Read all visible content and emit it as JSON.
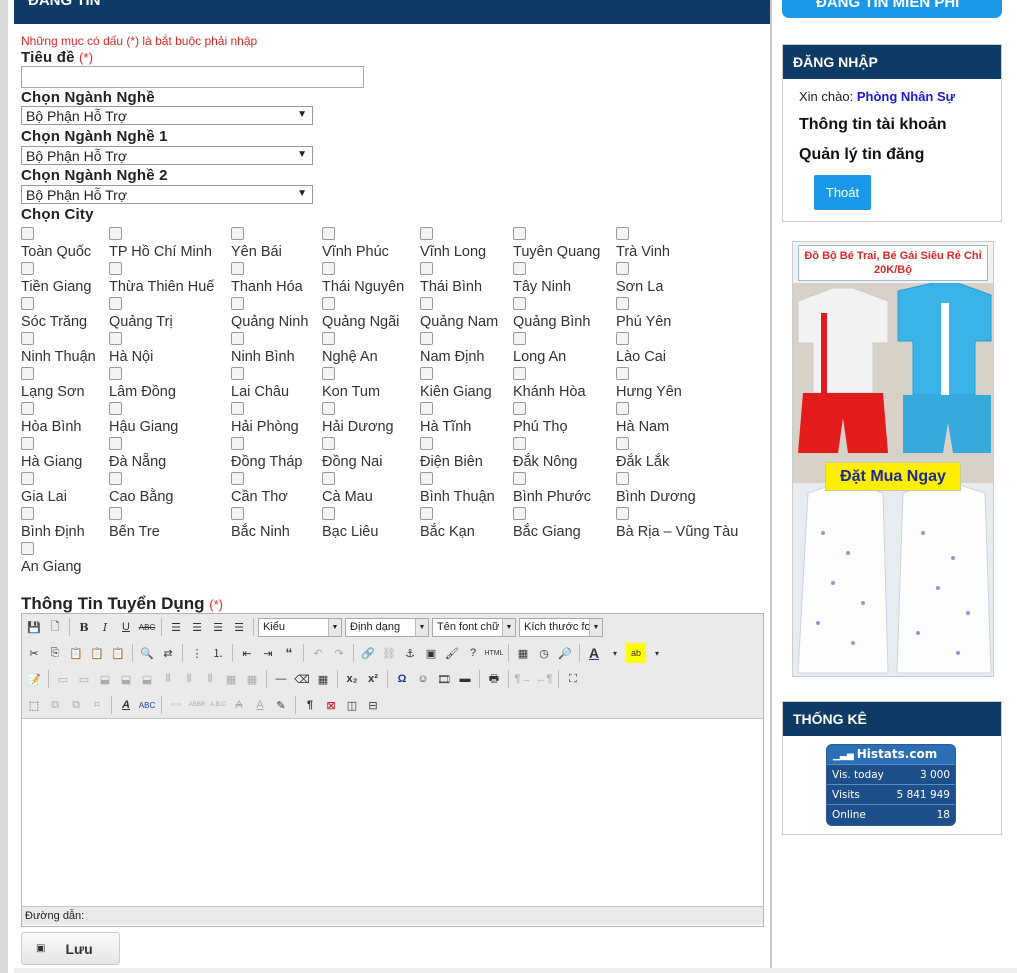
{
  "main": {
    "header_title": "ĐĂNG TIN",
    "required_note": "Những mục có dấu (*) là bắt buộc phải nhập",
    "title_label": "Tiêu đề",
    "required_mark": "(*)",
    "industry_label": "Chọn Ngành Nghề",
    "industry_value": "Bộ Phận Hỗ Trợ",
    "industry1_label": "Chọn Ngành Nghề 1",
    "industry1_value": "Bộ Phận Hỗ Trợ",
    "industry2_label": "Chọn Ngành Nghề 2",
    "industry2_value": "Bộ Phận Hỗ Trợ",
    "city_label": "Chọn City",
    "recruitment_label": "Thông Tin Tuyển Dụng",
    "save_label": "Lưu"
  },
  "cities": [
    [
      "Toàn Quốc",
      "TP Hồ Chí Minh",
      "Yên Bái",
      "Vĩnh Phúc",
      "Vĩnh Long",
      "Tuyên Quang",
      "Trà Vinh"
    ],
    [
      "Tiền Giang",
      "Thừa Thiên Huế",
      "Thanh Hóa",
      "Thái Nguyên",
      "Thái Bình",
      "Tây Ninh",
      "Sơn La"
    ],
    [
      "Sóc Trăng",
      "Quảng Trị",
      "Quảng Ninh",
      "Quảng Ngãi",
      "Quảng Nam",
      "Quảng Bình",
      "Phú Yên"
    ],
    [
      "Ninh Thuận",
      "Hà Nội",
      "Ninh Bình",
      "Nghệ An",
      "Nam Định",
      "Long An",
      "Lào Cai"
    ],
    [
      "Lạng Sơn",
      "Lâm Đồng",
      "Lai Châu",
      "Kon Tum",
      "Kiên Giang",
      "Khánh Hòa",
      "Hưng Yên"
    ],
    [
      "Hòa Bình",
      "Hậu Giang",
      "Hải Phòng",
      "Hải Dương",
      "Hà Tĩnh",
      "Phú Thọ",
      "Hà Nam"
    ],
    [
      "Hà Giang",
      "Đà Nẵng",
      "Đồng Tháp",
      "Đồng Nai",
      "Điện Biên",
      "Đắk Nông",
      "Đắk Lắk"
    ],
    [
      "Gia Lai",
      "Cao Bằng",
      "Cần Thơ",
      "Cà Mau",
      "Bình Thuận",
      "Bình Phước",
      "Bình Dương"
    ],
    [
      "Bình Định",
      "Bến Tre",
      "Bắc Ninh",
      "Bạc Liêu",
      "Bắc Kạn",
      "Bắc Giang",
      "Bà Rịa – Vũng Tàu"
    ],
    [
      "An Giang"
    ]
  ],
  "editor": {
    "style_combo": "Kiểu",
    "format_combo": "Định dạng",
    "font_combo": "Tên font chữ",
    "size_combo": "Kích thước fo",
    "path_label": "Đường dẫn:"
  },
  "sidebar": {
    "free_post_label": "ĐĂNG TIN MIỄN PHÍ",
    "login_title": "ĐĂNG NHẬP",
    "greeting": "Xin chào:",
    "user_name": "Phòng Nhân Sự",
    "account_info": "Thông tin tài khoản",
    "manage_posts": "Quản lý tin đăng",
    "logout_label": "Thoát",
    "stats_title": "THỐNG KÊ"
  },
  "ad": {
    "headline": "Đồ Bộ Bé Trai, Bé Gái Siêu Rẻ Chỉ 20K/Bộ",
    "cta": "Đặt Mua Ngay"
  },
  "histats": {
    "brand": "Histats.com",
    "rows": [
      {
        "label": "Vis. today",
        "value": "3 000"
      },
      {
        "label": "Visits",
        "value": "5 841 949"
      },
      {
        "label": "Online",
        "value": "18"
      }
    ]
  },
  "colors": {
    "navy": "#0e3a66",
    "accent_blue": "#1a99e8",
    "required_red": "#e0282a"
  }
}
